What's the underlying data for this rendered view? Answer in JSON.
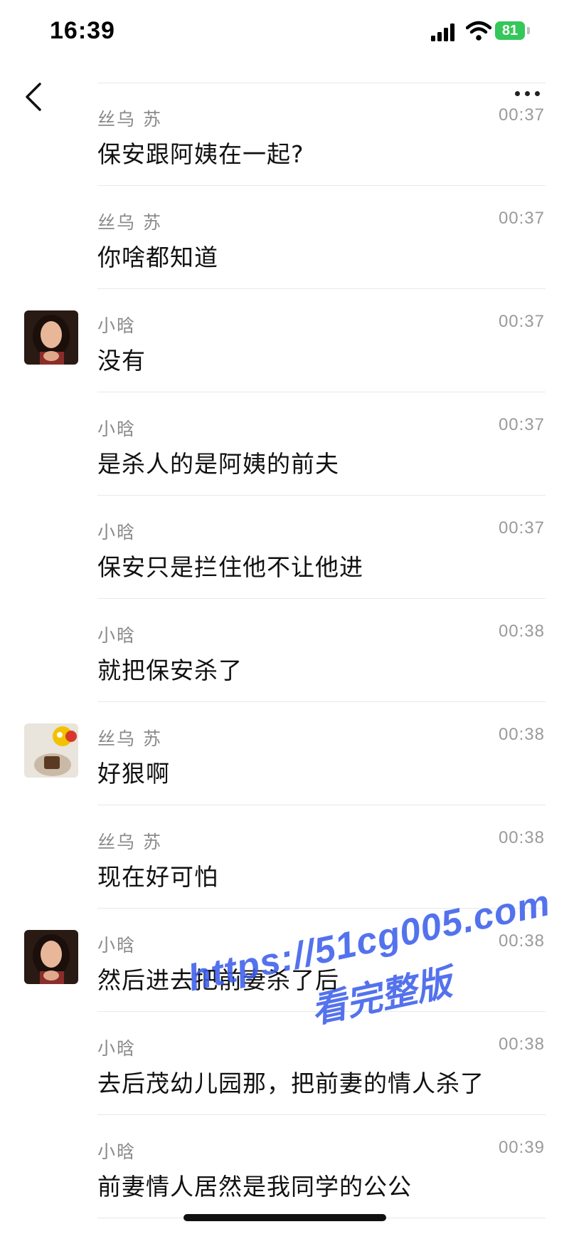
{
  "status_bar": {
    "time": "16:39",
    "battery": "81"
  },
  "nav": {
    "back_icon": "chevron-left-icon",
    "more_icon": "more-horizontal-icon"
  },
  "messages": [
    {
      "sender": "丝乌 苏",
      "time": "00:37",
      "text": "保安跟阿姨在一起?",
      "avatar": false
    },
    {
      "sender": "丝乌 苏",
      "time": "00:37",
      "text": "你啥都知道",
      "avatar": false
    },
    {
      "sender": "小晗",
      "time": "00:37",
      "text": "没有",
      "avatar": true
    },
    {
      "sender": "小晗",
      "time": "00:37",
      "text": "是杀人的是阿姨的前夫",
      "avatar": false
    },
    {
      "sender": "小晗",
      "time": "00:37",
      "text": "保安只是拦住他不让他进",
      "avatar": false
    },
    {
      "sender": "小晗",
      "time": "00:38",
      "text": "就把保安杀了",
      "avatar": false
    },
    {
      "sender": "丝乌 苏",
      "time": "00:38",
      "text": "好狠啊",
      "avatar": true
    },
    {
      "sender": "丝乌 苏",
      "time": "00:38",
      "text": "现在好可怕",
      "avatar": false
    },
    {
      "sender": "小晗",
      "time": "00:38",
      "text": "然后进去把前妻杀了后",
      "avatar": true
    },
    {
      "sender": "小晗",
      "time": "00:38",
      "text": "去后茂幼儿园那，把前妻的情人杀了",
      "avatar": false
    },
    {
      "sender": "小晗",
      "time": "00:39",
      "text": "前妻情人居然是我同学的公公",
      "avatar": false
    }
  ],
  "watermark": {
    "line1": "https://51cg005.com",
    "line2": "看完整版"
  }
}
